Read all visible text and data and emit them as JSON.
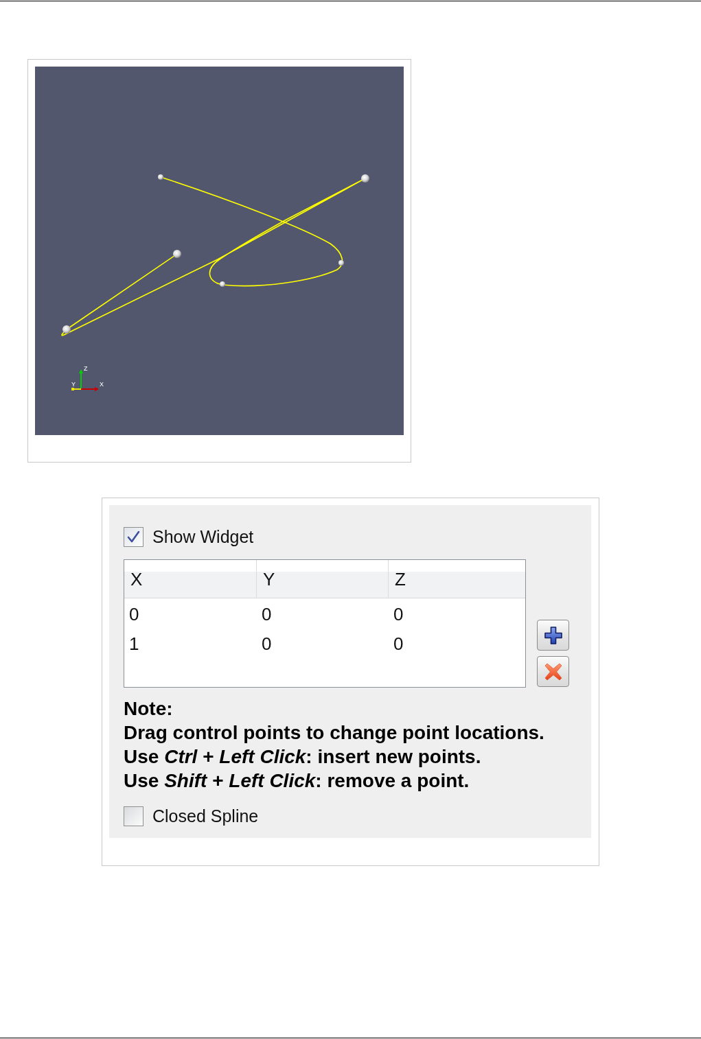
{
  "figure_1": {
    "viewport": {
      "axes": [
        {
          "label": "Z",
          "color": "#00d000"
        },
        {
          "label": "Y",
          "color": "#e8e800"
        },
        {
          "label": "X",
          "color": "#c80000"
        }
      ]
    }
  },
  "figure_2": {
    "panel": {
      "show_widget": {
        "label": "Show Widget",
        "checked": true
      },
      "table": {
        "columns": [
          "X",
          "Y",
          "Z"
        ],
        "rows": [
          [
            "0",
            "0",
            "0"
          ],
          [
            "1",
            "0",
            "0"
          ]
        ]
      },
      "buttons": [
        {
          "kind": "add"
        },
        {
          "kind": "remove"
        }
      ],
      "note": {
        "title": "Note:",
        "lines": [
          "Drag control points to change point locations.",
          "Use *Ctrl* + *Left Click*: insert new points.",
          "Use *Shift* + *Left Click*: remove a point."
        ]
      },
      "closed_spline": {
        "label": "Closed Spline",
        "checked": false
      }
    }
  }
}
